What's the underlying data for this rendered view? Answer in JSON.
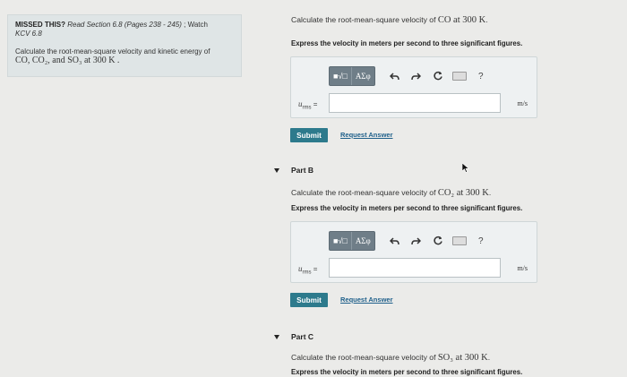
{
  "info": {
    "missed_label": "MISSED THIS?",
    "read_text": "Read Section 6.8",
    "pages_text": "(Pages 238 - 245)",
    "watch_text": "; Watch",
    "watch_ref": "KCV 6.8",
    "question_line1": "Calculate the root-mean-square velocity and kinetic energy of",
    "question_line2": "CO, CO₂, and SO₃ at 300 K ."
  },
  "part_a": {
    "prompt_pre": "Calculate the root-mean-square velocity of",
    "prompt_sym": "CO at 300 K",
    "prompt_post": ".",
    "instruction": "Express the velocity in meters per second to three significant figures.",
    "var_label": "u",
    "var_sub": "rms",
    "equals": "=",
    "input_value": "",
    "unit": "m/s",
    "submit": "Submit",
    "request": "Request Answer"
  },
  "part_b": {
    "header": "Part B",
    "prompt_pre": "Calculate the root-mean-square velocity of",
    "prompt_sym": "CO₂ at 300 K",
    "prompt_post": ".",
    "instruction": "Express the velocity in meters per second to three significant figures.",
    "var_label": "u",
    "var_sub": "rms",
    "equals": "=",
    "input_value": "",
    "unit": "m/s",
    "submit": "Submit",
    "request": "Request Answer"
  },
  "part_c": {
    "header": "Part C",
    "prompt_pre": "Calculate the root-mean-square velocity of",
    "prompt_sym": "SO₃ at 300 K",
    "prompt_post": ".",
    "instruction": "Express the velocity in meters per second to three significant figures."
  },
  "toolbar": {
    "templates_label": "■√□",
    "greek_label": "ΑΣφ",
    "undo_icon": "undo-icon",
    "redo_icon": "redo-icon",
    "reset_icon": "reset-icon",
    "keyboard_icon": "keyboard-icon",
    "help_label": "?"
  }
}
